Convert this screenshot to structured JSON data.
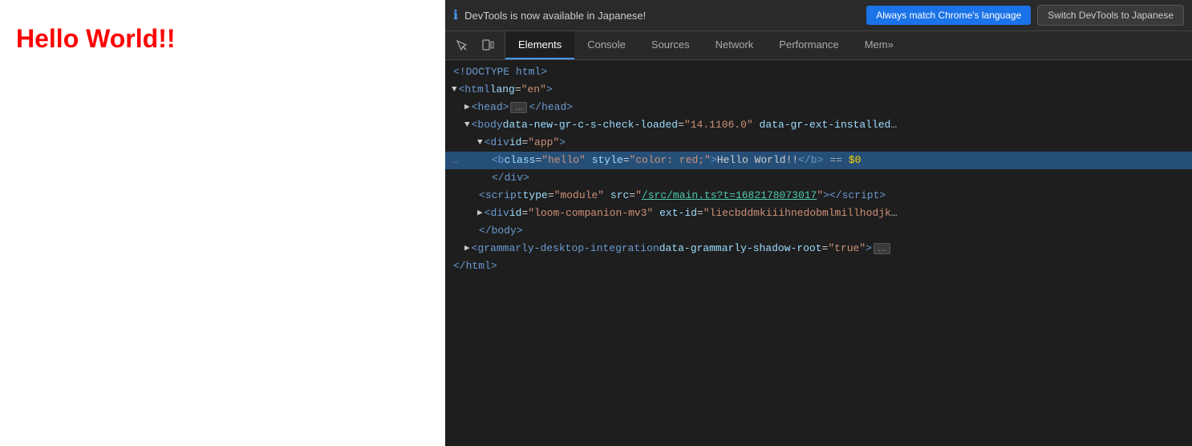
{
  "page": {
    "hello_text": "Hello World!!"
  },
  "notification": {
    "icon": "ℹ",
    "text": "DevTools is now available in Japanese!",
    "primary_btn": "Always match Chrome's language",
    "secondary_btn": "Switch DevTools to Japanese"
  },
  "tabs": {
    "icons": [
      "cursor",
      "square"
    ],
    "items": [
      {
        "label": "Elements",
        "active": true
      },
      {
        "label": "Console",
        "active": false
      },
      {
        "label": "Sources",
        "active": false
      },
      {
        "label": "Network",
        "active": false
      },
      {
        "label": "Performance",
        "active": false
      },
      {
        "label": "Mem...",
        "active": false
      }
    ]
  },
  "code": {
    "lines": [
      {
        "indent": 0,
        "content": "doctype",
        "type": "doctype"
      },
      {
        "indent": 0,
        "content": "html_open",
        "type": "html_open"
      },
      {
        "indent": 1,
        "content": "head",
        "type": "head"
      },
      {
        "indent": 1,
        "content": "body",
        "type": "body"
      },
      {
        "indent": 2,
        "content": "div_app",
        "type": "div_app"
      },
      {
        "indent": 3,
        "content": "b_hello",
        "type": "b_hello",
        "selected": true
      },
      {
        "indent": 3,
        "content": "div_close",
        "type": "div_close"
      },
      {
        "indent": 2,
        "content": "script",
        "type": "script"
      },
      {
        "indent": 2,
        "content": "div_loom",
        "type": "div_loom"
      },
      {
        "indent": 1,
        "content": "body_close",
        "type": "body_close"
      },
      {
        "indent": 1,
        "content": "grammarly",
        "type": "grammarly"
      },
      {
        "indent": 0,
        "content": "html_close",
        "type": "html_close"
      }
    ]
  }
}
